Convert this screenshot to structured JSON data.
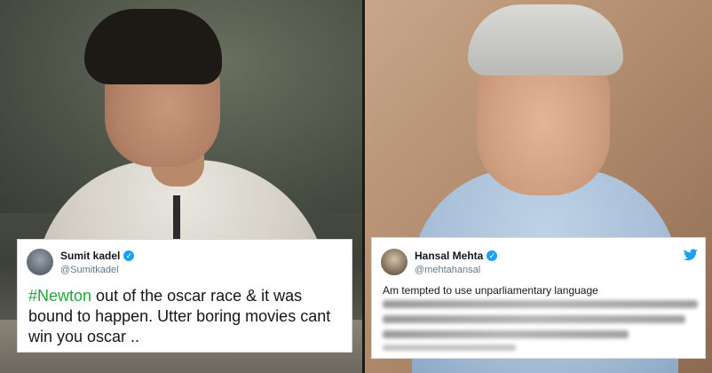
{
  "tweets": {
    "left": {
      "name": "Sumit kadel",
      "handle": "@Sumitkadel",
      "hashtag": "#Newton",
      "text": " out of the oscar race & it was bound to happen. Utter boring movies cant win you oscar .."
    },
    "right": {
      "name": "Hansal Mehta",
      "handle": "@mehtahansal",
      "text": "Am tempted to use unparliamentary language"
    }
  },
  "colors": {
    "verified": "#1da1f2",
    "hashtag": "#1fa73a",
    "twitter_bird": "#1da1f2"
  },
  "icons": {
    "verified": "verified-badge-icon",
    "bird": "twitter-bird-icon"
  }
}
